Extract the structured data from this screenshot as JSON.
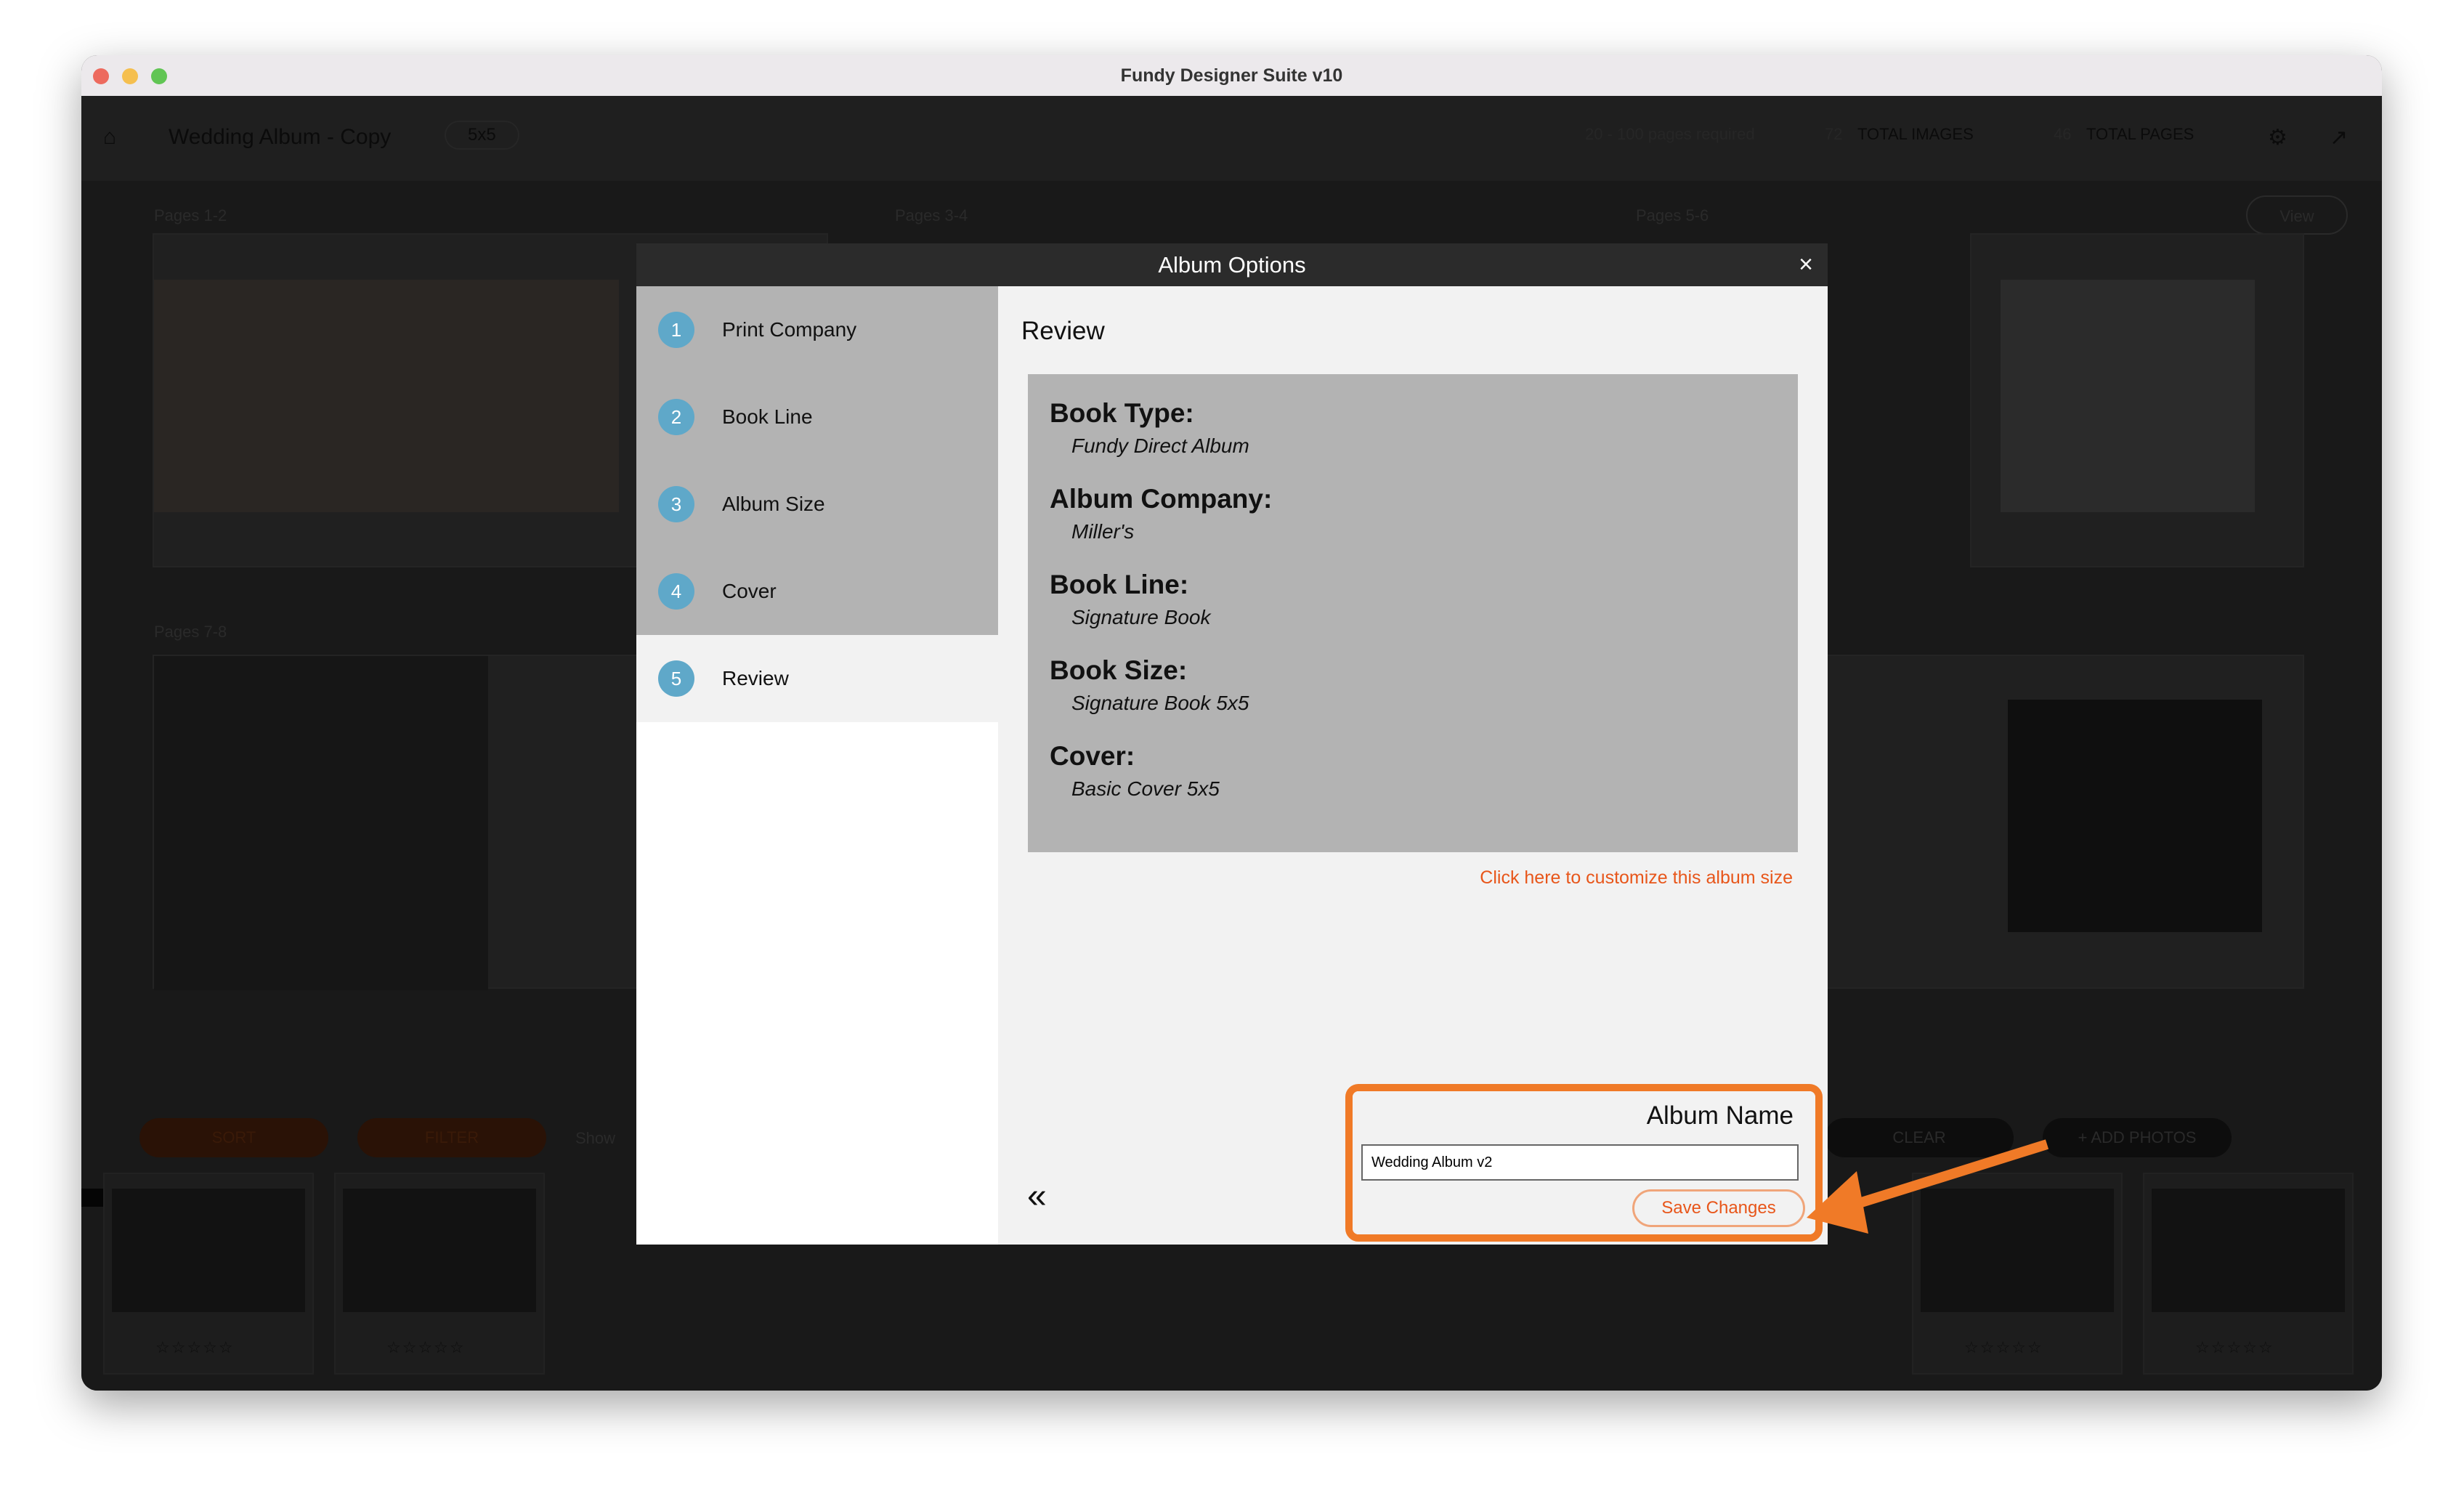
{
  "window": {
    "title": "Fundy Designer Suite v10"
  },
  "toolbar": {
    "album_title": "Wedding Album - Copy",
    "size_badge": "5x5",
    "pages_required": "20 - 100 pages required",
    "total_images_count": "72",
    "total_images_label": "TOTAL IMAGES",
    "total_pages_count": "46",
    "total_pages_label": "TOTAL PAGES",
    "view_label": "View"
  },
  "spreads": {
    "labels": [
      "Pages 1-2",
      "Pages 3-4",
      "Pages 5-6",
      "Pages 7-8"
    ]
  },
  "bottom": {
    "sort": "SORT",
    "filter": "FILTER",
    "show": "Show",
    "clear": "CLEAR",
    "add_photos": "+ ADD PHOTOS",
    "stars": "☆☆☆☆☆",
    "heart": "♡"
  },
  "modal": {
    "title": "Album Options",
    "steps": [
      {
        "n": "1",
        "label": "Print Company"
      },
      {
        "n": "2",
        "label": "Book Line"
      },
      {
        "n": "3",
        "label": "Album Size"
      },
      {
        "n": "4",
        "label": "Cover"
      },
      {
        "n": "5",
        "label": "Review"
      }
    ],
    "active_step": 5,
    "review_title": "Review",
    "review": [
      {
        "label": "Book Type:",
        "value": "Fundy Direct Album"
      },
      {
        "label": "Album Company:",
        "value": "Miller's"
      },
      {
        "label": "Book Line:",
        "value": "Signature Book"
      },
      {
        "label": "Book Size:",
        "value": "Signature Book 5x5"
      },
      {
        "label": "Cover:",
        "value": "Basic Cover 5x5"
      }
    ],
    "customize_link": "Click here to customize this album size",
    "album_name_label": "Album Name",
    "album_name_value": "Wedding Album v2",
    "save_label": "Save Changes",
    "back_icon": "«"
  },
  "colors": {
    "accent": "#f07a27",
    "link": "#e8561a",
    "step": "#5fa8c9"
  }
}
